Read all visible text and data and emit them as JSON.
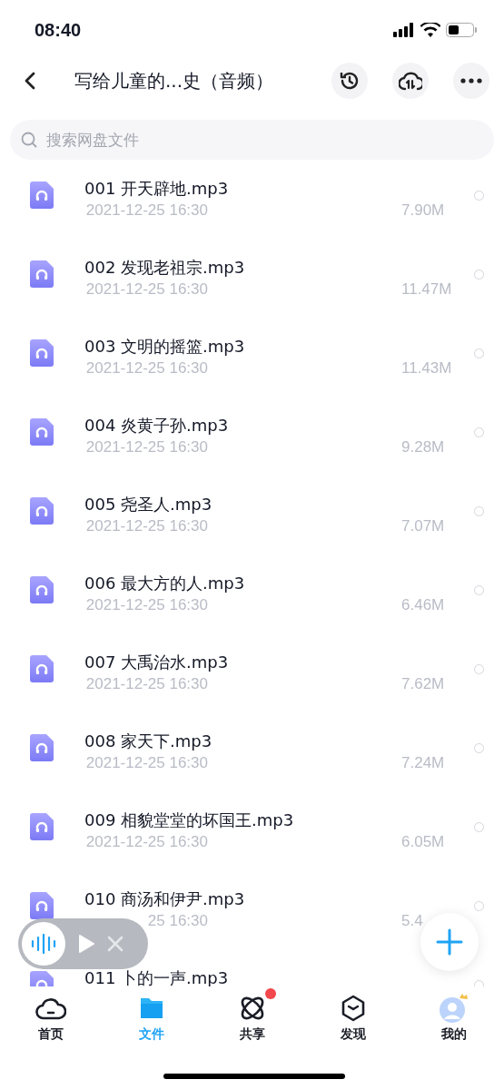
{
  "status_bar": {
    "time": "08:40"
  },
  "header": {
    "title": "写给儿童的...史（音频）"
  },
  "search": {
    "placeholder": "搜索网盘文件"
  },
  "files": [
    {
      "name": "001 开天辟地.mp3",
      "date": "2021-12-25 16:30",
      "size": "7.90M",
      "selected": false
    },
    {
      "name": "002 发现老祖宗.mp3",
      "date": "2021-12-25 16:30",
      "size": "11.47M",
      "selected": false
    },
    {
      "name": "003 文明的摇篮.mp3",
      "date": "2021-12-25 16:30",
      "size": "11.43M",
      "selected": false
    },
    {
      "name": "004 炎黄子孙.mp3",
      "date": "2021-12-25 16:30",
      "size": "9.28M",
      "selected": false
    },
    {
      "name": "005 尧圣人.mp3",
      "date": "2021-12-25 16:30",
      "size": "7.07M",
      "selected": false
    },
    {
      "name": "006 最大方的人.mp3",
      "date": "2021-12-25 16:30",
      "size": "6.46M",
      "selected": false
    },
    {
      "name": "007 大禹治水.mp3",
      "date": "2021-12-25 16:30",
      "size": "7.62M",
      "selected": false
    },
    {
      "name": "008 家天下.mp3",
      "date": "2021-12-25 16:30",
      "size": "7.24M",
      "selected": false
    },
    {
      "name": "009 相貌堂堂的坏国王.mp3",
      "date": "2021-12-25 16:30",
      "size": "6.05M",
      "selected": false
    },
    {
      "name": "010 商汤和伊尹.mp3",
      "date": "25 16:30",
      "size": "5.4",
      "selected": false
    },
    {
      "name": "011 卜的一声.mp3",
      "selected": false
    }
  ],
  "tabs": [
    {
      "kind": "home",
      "label": "首页",
      "selected": false,
      "badge": false
    },
    {
      "kind": "files",
      "label": "文件",
      "selected": true,
      "badge": false
    },
    {
      "kind": "share",
      "label": "共享",
      "selected": false,
      "badge": true
    },
    {
      "kind": "discover",
      "label": "发现",
      "selected": false,
      "badge": false
    },
    {
      "kind": "me",
      "label": "我的",
      "selected": false,
      "badge": false
    }
  ]
}
